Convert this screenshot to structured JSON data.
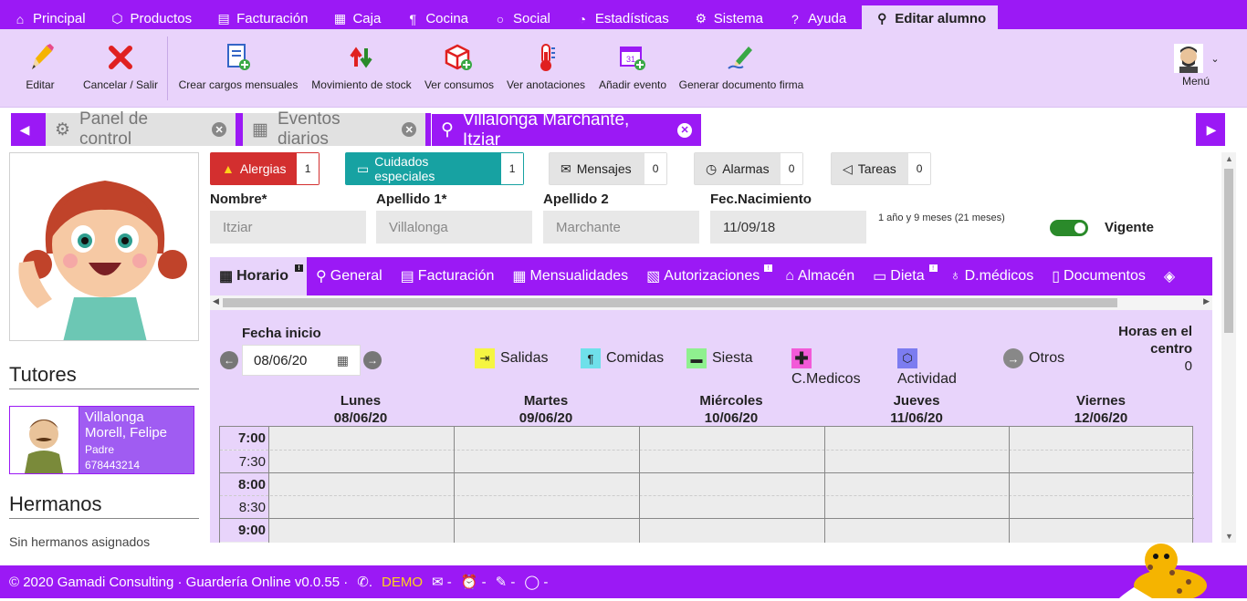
{
  "topmenu": {
    "items": [
      {
        "label": "Principal",
        "icon": "home-icon"
      },
      {
        "label": "Productos",
        "icon": "cube-icon"
      },
      {
        "label": "Facturación",
        "icon": "document-icon"
      },
      {
        "label": "Caja",
        "icon": "cash-register-icon"
      },
      {
        "label": "Cocina",
        "icon": "utensils-icon"
      },
      {
        "label": "Social",
        "icon": "chat-icon"
      },
      {
        "label": "Estadísticas",
        "icon": "pie-chart-icon"
      },
      {
        "label": "Sistema",
        "icon": "gears-icon"
      },
      {
        "label": "Ayuda",
        "icon": "help-icon"
      }
    ],
    "active": {
      "label": "Editar alumno",
      "icon": "child-icon"
    }
  },
  "toolbar": {
    "editar": "Editar",
    "cancelar": "Cancelar / Salir",
    "crear_cargos": "Crear cargos mensuales",
    "movimiento_stock": "Movimiento de stock",
    "ver_consumos": "Ver consumos",
    "ver_anotaciones": "Ver anotaciones",
    "anadir_evento": "Añadir evento",
    "generar_documento": "Generar documento firma",
    "menu": "Menú"
  },
  "page_tabs": [
    {
      "label": "Panel de control",
      "icon": "dashboard-icon"
    },
    {
      "label": "Eventos diarios",
      "icon": "calendar-icon"
    },
    {
      "label": "Villalonga Marchante, Itziar",
      "icon": "child-icon"
    }
  ],
  "badges": {
    "alergias": {
      "label": "Alergias",
      "count": "1",
      "color": "#d32f2f"
    },
    "cuidados": {
      "label": "Cuidados especiales",
      "count": "1",
      "color": "#17a2a2"
    },
    "mensajes": {
      "label": "Mensajes",
      "count": "0"
    },
    "alarmas": {
      "label": "Alarmas",
      "count": "0"
    },
    "tareas": {
      "label": "Tareas",
      "count": "0"
    }
  },
  "student": {
    "nombre_label": "Nombre*",
    "nombre": "Itziar",
    "apellido1_label": "Apellido 1*",
    "apellido1": "Villalonga",
    "apellido2_label": "Apellido 2",
    "apellido2": "Marchante",
    "fecnac_label": "Fec.Nacimiento",
    "fecnac": "11/09/18",
    "edad": "1 año y 9 meses (21 meses)",
    "vigente_label": "Vigente",
    "vigente": true
  },
  "subtabs": [
    {
      "label": "Horario",
      "active": true,
      "notif": true
    },
    {
      "label": "General"
    },
    {
      "label": "Facturación"
    },
    {
      "label": "Mensualidades"
    },
    {
      "label": "Autorizaciones",
      "notif": true
    },
    {
      "label": "Almacén"
    },
    {
      "label": "Dieta",
      "notif": true
    },
    {
      "label": "D.médicos"
    },
    {
      "label": "Documentos"
    }
  ],
  "horario": {
    "fecha_inicio_label": "Fecha inicio",
    "fecha_inicio": "08/06/20",
    "legend": {
      "salidas": "Salidas",
      "comidas": "Comidas",
      "siesta": "Siesta",
      "cmedicos": "C.Medicos",
      "actividad": "Actividad",
      "otros": "Otros"
    },
    "horas_label_1": "Horas en el",
    "horas_label_2": "centro",
    "horas_value": "0",
    "days": [
      {
        "name": "Lunes",
        "date": "08/06/20"
      },
      {
        "name": "Martes",
        "date": "09/06/20"
      },
      {
        "name": "Miércoles",
        "date": "10/06/20"
      },
      {
        "name": "Jueves",
        "date": "11/06/20"
      },
      {
        "name": "Viernes",
        "date": "12/06/20"
      }
    ],
    "times": [
      "7:00",
      "7:30",
      "8:00",
      "8:30",
      "9:00"
    ]
  },
  "left": {
    "tutores_title": "Tutores",
    "tutor": {
      "name": "Villalonga Morell, Felipe",
      "role": "Padre",
      "phone": "678443214"
    },
    "hermanos_title": "Hermanos",
    "sin_hermanos": "Sin hermanos asignados"
  },
  "footer": {
    "copyright": "© 2020 Gamadi Consulting · Guardería Online v0.0.55 ·",
    "demo": "DEMO",
    "dash": "-"
  },
  "colors": {
    "brand": "#9b19f5",
    "brand_light": "#e8d4fb"
  }
}
